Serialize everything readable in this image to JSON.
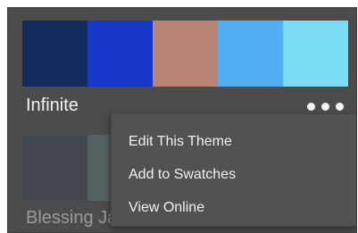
{
  "themes": [
    {
      "name": "Infinite",
      "swatches": [
        "#142d5e",
        "#1838c9",
        "#b88473",
        "#52aef2",
        "#7bdcf4"
      ]
    },
    {
      "name": "Blessing Jakes Room",
      "swatches": [
        "#3a4550",
        "#5a7574"
      ]
    }
  ],
  "more_icon": "ellipsis-icon",
  "context_menu": {
    "items": [
      {
        "label": "Edit This Theme"
      },
      {
        "label": "Add to Swatches"
      },
      {
        "label": "View Online"
      }
    ]
  }
}
